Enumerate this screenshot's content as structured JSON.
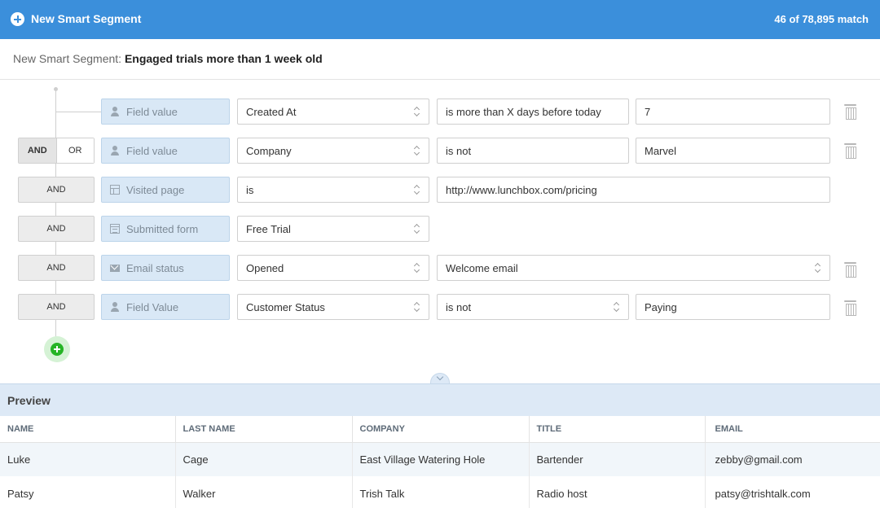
{
  "header": {
    "title": "New Smart Segment",
    "match_count": "46 of 78,895 match"
  },
  "segment": {
    "label": "New Smart Segment:",
    "name": "Engaged trials more than 1 week old"
  },
  "logic": {
    "and": "AND",
    "or": "OR"
  },
  "rules": [
    {
      "connector": "",
      "type_icon": "person-icon",
      "type": "Field value",
      "field": "Created At",
      "operator": "is more than X days before today",
      "value": "7",
      "deletable": true
    },
    {
      "connector": "AND|OR",
      "type_icon": "person-icon",
      "type": "Field value",
      "field": "Company",
      "operator": "is not",
      "value": "Marvel",
      "deletable": true
    },
    {
      "connector": "AND",
      "type_icon": "page-icon",
      "type": "Visited page",
      "field": "is",
      "operator": "http://www.lunchbox.com/pricing",
      "deletable": false
    },
    {
      "connector": "AND",
      "type_icon": "form-icon",
      "type": "Submitted form",
      "field": "Free Trial",
      "deletable": false
    },
    {
      "connector": "AND",
      "type_icon": "mail-icon",
      "type": "Email status",
      "field": "Opened",
      "operator": "Welcome email",
      "deletable": true
    },
    {
      "connector": "AND",
      "type_icon": "person-icon",
      "type": "Field Value",
      "field": "Customer Status",
      "operator": "is not",
      "value": "Paying",
      "deletable": true
    }
  ],
  "preview": {
    "title": "Preview",
    "columns": [
      "NAME",
      "LAST NAME",
      "COMPANY",
      "TITLE",
      "EMAIL"
    ],
    "rows": [
      [
        "Luke",
        "Cage",
        "East Village Watering Hole",
        "Bartender",
        "zebby@gmail.com"
      ],
      [
        "Patsy",
        "Walker",
        "Trish Talk",
        "Radio host",
        "patsy@trishtalk.com"
      ]
    ]
  },
  "colors": {
    "header_bg": "#3b8fdb",
    "type_chip_bg": "#d9e8f6",
    "add_button": "#25b425",
    "preview_bg": "#dde9f6"
  }
}
